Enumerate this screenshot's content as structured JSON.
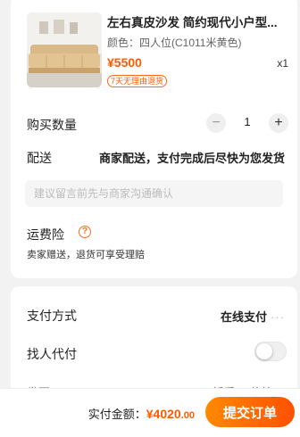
{
  "product": {
    "title": "左右真皮沙发 简约现代小户型...",
    "spec": "颜色：四人位(C1011米黄色)",
    "price": "¥5500",
    "quantity": "x1",
    "return_badge": "7天无理由退货"
  },
  "order": {
    "quantity_label": "购买数量",
    "quantity_value": "1",
    "minus": "−",
    "plus": "+",
    "delivery_label": "配送",
    "delivery_value": "商家配送，支付完成后尽快为您发货",
    "message_placeholder": "建议留言前先与商家沟通确认",
    "insurance_label": "运费险",
    "insurance_help": "?",
    "insurance_desc": "卖家赠送，退货可享受理赔"
  },
  "payment": {
    "method_label": "支付方式",
    "method_value": "在线支付",
    "more": "···",
    "proxy_label": "找人代付",
    "proxy_enabled": false,
    "partial_label": "发票",
    "partial_value": "纸质 不体抬"
  },
  "footer": {
    "total_label": "实付金额：",
    "total_amount": "¥4020",
    "total_cents": ".00",
    "submit_label": "提交订单"
  },
  "colors": {
    "accent": "#ff5a00",
    "background": "#f2f2f2"
  }
}
